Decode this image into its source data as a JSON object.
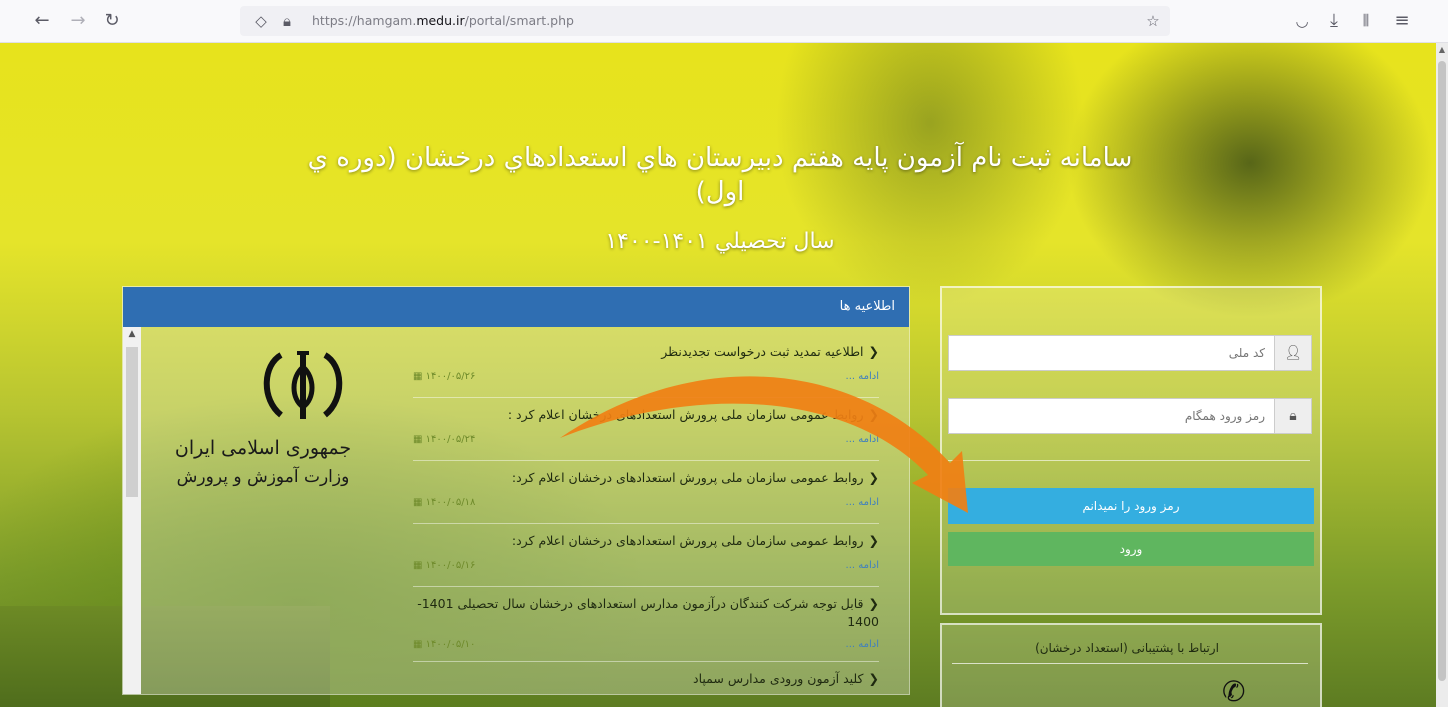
{
  "browser": {
    "back_icon": "arrow-left-icon",
    "forward_icon": "arrow-right-icon",
    "reload_icon": "reload-icon",
    "url_prefix": "https://hamgam.",
    "url_domain": "medu.ir",
    "url_path": "/portal/smart.php"
  },
  "header": {
    "title": "سامانه ثبت نام آزمون پايه هفتم دبيرستان هاي استعدادهاي درخشان (دوره ي اول)",
    "year": "سال تحصيلي ۱۴۰۱-۱۴۰۰"
  },
  "announcements": {
    "heading": "اطلاعیه ها",
    "emblem_line1": "جمهوری اسلامی ایران",
    "emblem_line2": "وزارت آموزش و پرورش",
    "more_label": "ادامه ...",
    "items": [
      {
        "title": "اطلاعیه تمدید ثبت درخواست تجدیدنظر",
        "date": "۱۴۰۰/۰۵/۲۶"
      },
      {
        "title": "روابط عمومی سازمان ملی پرورش استعدادهای درخشان اعلام کرد :",
        "date": "۱۴۰۰/۰۵/۲۴"
      },
      {
        "title": "روابط عمومی سازمان ملی پرورش استعدادهای درخشان اعلام کرد:",
        "date": "۱۴۰۰/۰۵/۱۸"
      },
      {
        "title": "روابط عمومی سازمان ملی پرورش استعدادهای درخشان اعلام کرد:",
        "date": "۱۴۰۰/۰۵/۱۶"
      },
      {
        "title": "قابل توجه شرکت کنندگان درآزمون مدارس استعدادهای درخشان سال تحصیلی 1401-1400",
        "date": "۱۴۰۰/۰۵/۱۰"
      },
      {
        "title": "کلید آزمون ورودی مدارس سمپاد",
        "date": ""
      }
    ]
  },
  "login": {
    "national_code_placeholder": "کد ملی",
    "password_placeholder": "رمز ورود همگام",
    "forgot_label": "رمز ورود را نمیدانم",
    "login_label": "ورود"
  },
  "support": {
    "title": "ارتباط با پشتیبانی (استعداد درخشان)"
  },
  "colors": {
    "header_blue": "#2f6eb2",
    "forgot_btn": "#34aee0",
    "login_btn": "#5fb65f",
    "arrow_orange": "#f07f13"
  }
}
